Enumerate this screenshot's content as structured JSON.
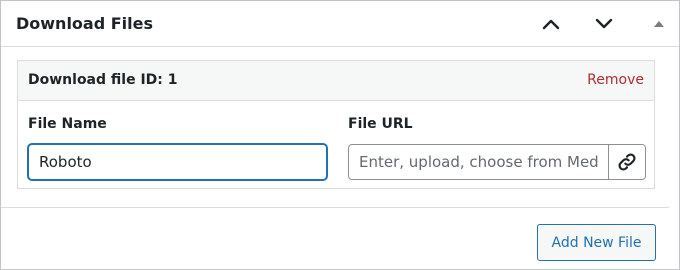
{
  "panel": {
    "title": "Download Files"
  },
  "file": {
    "id_label": "Download file ID: 1",
    "remove_label": "Remove",
    "name_label": "File Name",
    "name_value": "Roboto",
    "url_label": "File URL",
    "url_placeholder": "Enter, upload, choose from Media"
  },
  "footer": {
    "add_label": "Add New File"
  },
  "colors": {
    "accent": "#2271b1",
    "danger": "#b32d2e"
  },
  "icons": {
    "move_up": "chevron-up-icon",
    "move_down": "chevron-down-icon",
    "toggle": "caret-up-icon",
    "link": "link-icon"
  }
}
